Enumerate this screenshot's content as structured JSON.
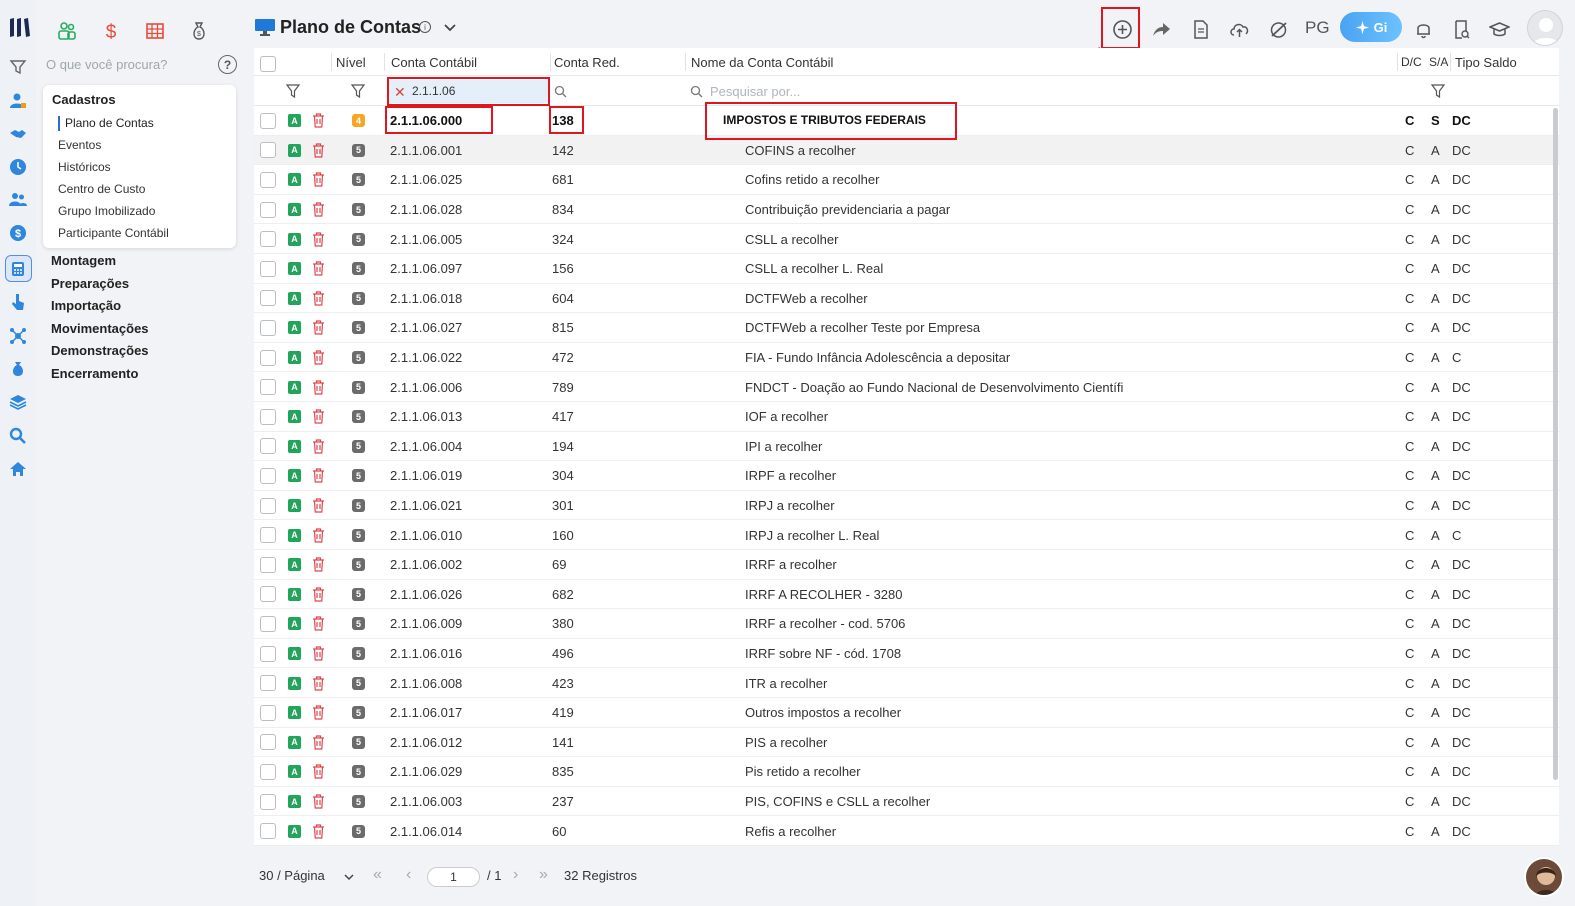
{
  "sidebar": {
    "search_placeholder": "O que você procura?",
    "help": "?",
    "card": {
      "title": "Cadastros",
      "items": [
        "Plano de Contas",
        "Eventos",
        "Históricos",
        "Centro de Custo",
        "Grupo Imobilizado",
        "Participante Contábil"
      ]
    },
    "groups": [
      "Montagem",
      "Preparações",
      "Importação",
      "Movimentações",
      "Demonstrações",
      "Encerramento"
    ]
  },
  "header": {
    "title": "Plano de Contas",
    "info": "i",
    "pg_label": "PG",
    "gi_label": "Gi"
  },
  "table": {
    "columns": {
      "nivel": "Nível",
      "conta": "Conta Contábil",
      "red": "Conta Red.",
      "nome": "Nome da Conta Contábil",
      "dc": "D/C",
      "sa": "S/A",
      "tipo": "Tipo Saldo"
    },
    "filter_value": "2.1.1.06",
    "filter_clear": "✕",
    "name_search_placeholder": "Pesquisar por...",
    "rows": [
      {
        "status": "A",
        "level": "4",
        "conta": "2.1.1.06.000",
        "red": "138",
        "nome": "IMPOSTOS E TRIBUTOS FEDERAIS",
        "dc": "C",
        "sa": "S",
        "tipo": "DC"
      },
      {
        "status": "A",
        "level": "5",
        "conta": "2.1.1.06.001",
        "red": "142",
        "nome": "COFINS a recolher",
        "dc": "C",
        "sa": "A",
        "tipo": "DC"
      },
      {
        "status": "A",
        "level": "5",
        "conta": "2.1.1.06.025",
        "red": "681",
        "nome": "Cofins retido a recolher",
        "dc": "C",
        "sa": "A",
        "tipo": "DC"
      },
      {
        "status": "A",
        "level": "5",
        "conta": "2.1.1.06.028",
        "red": "834",
        "nome": "Contribuição previdenciaria a pagar",
        "dc": "C",
        "sa": "A",
        "tipo": "DC"
      },
      {
        "status": "A",
        "level": "5",
        "conta": "2.1.1.06.005",
        "red": "324",
        "nome": "CSLL a recolher",
        "dc": "C",
        "sa": "A",
        "tipo": "DC"
      },
      {
        "status": "A",
        "level": "5",
        "conta": "2.1.1.06.097",
        "red": "156",
        "nome": "CSLL a recolher L. Real",
        "dc": "C",
        "sa": "A",
        "tipo": "DC"
      },
      {
        "status": "A",
        "level": "5",
        "conta": "2.1.1.06.018",
        "red": "604",
        "nome": "DCTFWeb a recolher",
        "dc": "C",
        "sa": "A",
        "tipo": "DC"
      },
      {
        "status": "A",
        "level": "5",
        "conta": "2.1.1.06.027",
        "red": "815",
        "nome": "DCTFWeb a recolher Teste por Empresa",
        "dc": "C",
        "sa": "A",
        "tipo": "DC"
      },
      {
        "status": "A",
        "level": "5",
        "conta": "2.1.1.06.022",
        "red": "472",
        "nome": "FIA - Fundo Infância Adolescência a depositar",
        "dc": "C",
        "sa": "A",
        "tipo": "C"
      },
      {
        "status": "A",
        "level": "5",
        "conta": "2.1.1.06.006",
        "red": "789",
        "nome": "FNDCT - Doação ao Fundo Nacional de Desenvolvimento Científi",
        "dc": "C",
        "sa": "A",
        "tipo": "DC"
      },
      {
        "status": "A",
        "level": "5",
        "conta": "2.1.1.06.013",
        "red": "417",
        "nome": "IOF a recolher",
        "dc": "C",
        "sa": "A",
        "tipo": "DC"
      },
      {
        "status": "A",
        "level": "5",
        "conta": "2.1.1.06.004",
        "red": "194",
        "nome": "IPI a recolher",
        "dc": "C",
        "sa": "A",
        "tipo": "DC"
      },
      {
        "status": "A",
        "level": "5",
        "conta": "2.1.1.06.019",
        "red": "304",
        "nome": "IRPF a recolher",
        "dc": "C",
        "sa": "A",
        "tipo": "DC"
      },
      {
        "status": "A",
        "level": "5",
        "conta": "2.1.1.06.021",
        "red": "301",
        "nome": "IRPJ a recolher",
        "dc": "C",
        "sa": "A",
        "tipo": "DC"
      },
      {
        "status": "A",
        "level": "5",
        "conta": "2.1.1.06.010",
        "red": "160",
        "nome": "IRPJ a recolher L. Real",
        "dc": "C",
        "sa": "A",
        "tipo": "C"
      },
      {
        "status": "A",
        "level": "5",
        "conta": "2.1.1.06.002",
        "red": "69",
        "nome": "IRRF a recolher",
        "dc": "C",
        "sa": "A",
        "tipo": "DC"
      },
      {
        "status": "A",
        "level": "5",
        "conta": "2.1.1.06.026",
        "red": "682",
        "nome": "IRRF A RECOLHER - 3280",
        "dc": "C",
        "sa": "A",
        "tipo": "DC"
      },
      {
        "status": "A",
        "level": "5",
        "conta": "2.1.1.06.009",
        "red": "380",
        "nome": "IRRF a recolher - cod. 5706",
        "dc": "C",
        "sa": "A",
        "tipo": "DC"
      },
      {
        "status": "A",
        "level": "5",
        "conta": "2.1.1.06.016",
        "red": "496",
        "nome": "IRRF sobre NF - cód. 1708",
        "dc": "C",
        "sa": "A",
        "tipo": "DC"
      },
      {
        "status": "A",
        "level": "5",
        "conta": "2.1.1.06.008",
        "red": "423",
        "nome": "ITR a recolher",
        "dc": "C",
        "sa": "A",
        "tipo": "DC"
      },
      {
        "status": "A",
        "level": "5",
        "conta": "2.1.1.06.017",
        "red": "419",
        "nome": "Outros impostos a recolher",
        "dc": "C",
        "sa": "A",
        "tipo": "DC"
      },
      {
        "status": "A",
        "level": "5",
        "conta": "2.1.1.06.012",
        "red": "141",
        "nome": "PIS a recolher",
        "dc": "C",
        "sa": "A",
        "tipo": "DC"
      },
      {
        "status": "A",
        "level": "5",
        "conta": "2.1.1.06.029",
        "red": "835",
        "nome": "Pis retido a recolher",
        "dc": "C",
        "sa": "A",
        "tipo": "DC"
      },
      {
        "status": "A",
        "level": "5",
        "conta": "2.1.1.06.003",
        "red": "237",
        "nome": "PIS, COFINS e CSLL a recolher",
        "dc": "C",
        "sa": "A",
        "tipo": "DC"
      },
      {
        "status": "A",
        "level": "5",
        "conta": "2.1.1.06.014",
        "red": "60",
        "nome": "Refis a recolher",
        "dc": "C",
        "sa": "A",
        "tipo": "DC"
      }
    ]
  },
  "pagination": {
    "per_page": "30 / Página",
    "first": "«",
    "prev": "‹",
    "current_page": "1",
    "total_pages": "/ 1",
    "next": "›",
    "last": "»",
    "records": "32 Registros"
  },
  "colors": {
    "accent": "#2a6cd2",
    "status_green": "#22a55b",
    "level4": "#f5a623",
    "level5": "#6b6b6b",
    "delete_red": "#e0464e",
    "highlight_red": "#e0161e"
  }
}
